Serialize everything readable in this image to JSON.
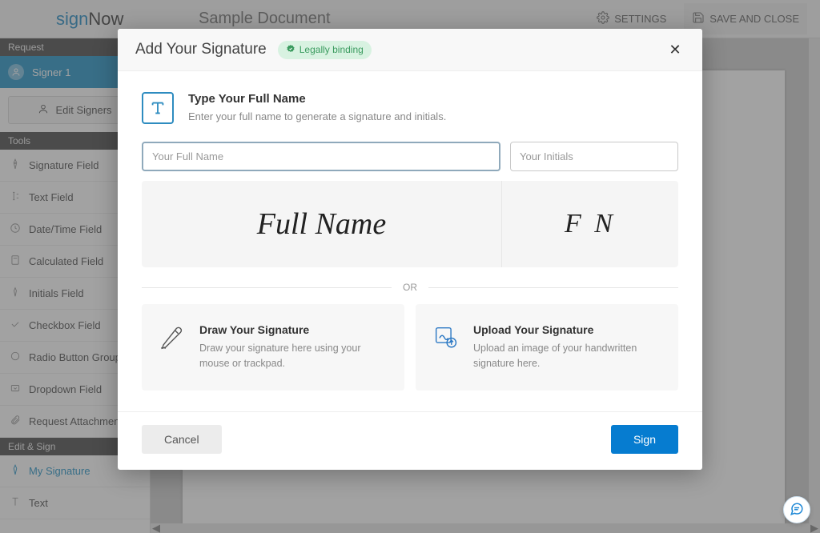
{
  "brand": {
    "sign": "sign",
    "now": "Now"
  },
  "document_title": "Sample Document",
  "top_actions": {
    "settings": "SETTINGS",
    "save_close": "SAVE AND CLOSE"
  },
  "sidebar": {
    "request_header": "Request",
    "signer_label": "Signer 1",
    "edit_signers": "Edit Signers",
    "tools_header": "Tools",
    "tools": [
      "Signature Field",
      "Text Field",
      "Date/Time Field",
      "Calculated Field",
      "Initials Field",
      "Checkbox Field",
      "Radio Button Group",
      "Dropdown Field",
      "Request Attachment"
    ],
    "editsign_header": "Edit & Sign",
    "editsign": [
      "My Signature",
      "Text"
    ]
  },
  "modal": {
    "title": "Add Your Signature",
    "badge": "Legally binding",
    "type_section": {
      "heading": "Type Your Full Name",
      "sub": "Enter your full name to generate a signature and initials."
    },
    "inputs": {
      "name_placeholder": "Your Full Name",
      "initials_placeholder": "Your Initials"
    },
    "preview": {
      "name": "Full Name",
      "initials": "F N"
    },
    "or": "OR",
    "draw": {
      "heading": "Draw Your Signature",
      "sub": "Draw your signature here using your mouse or trackpad."
    },
    "upload": {
      "heading": "Upload Your Signature",
      "sub": "Upload an image of your handwritten signature here."
    },
    "cancel": "Cancel",
    "sign": "Sign"
  }
}
